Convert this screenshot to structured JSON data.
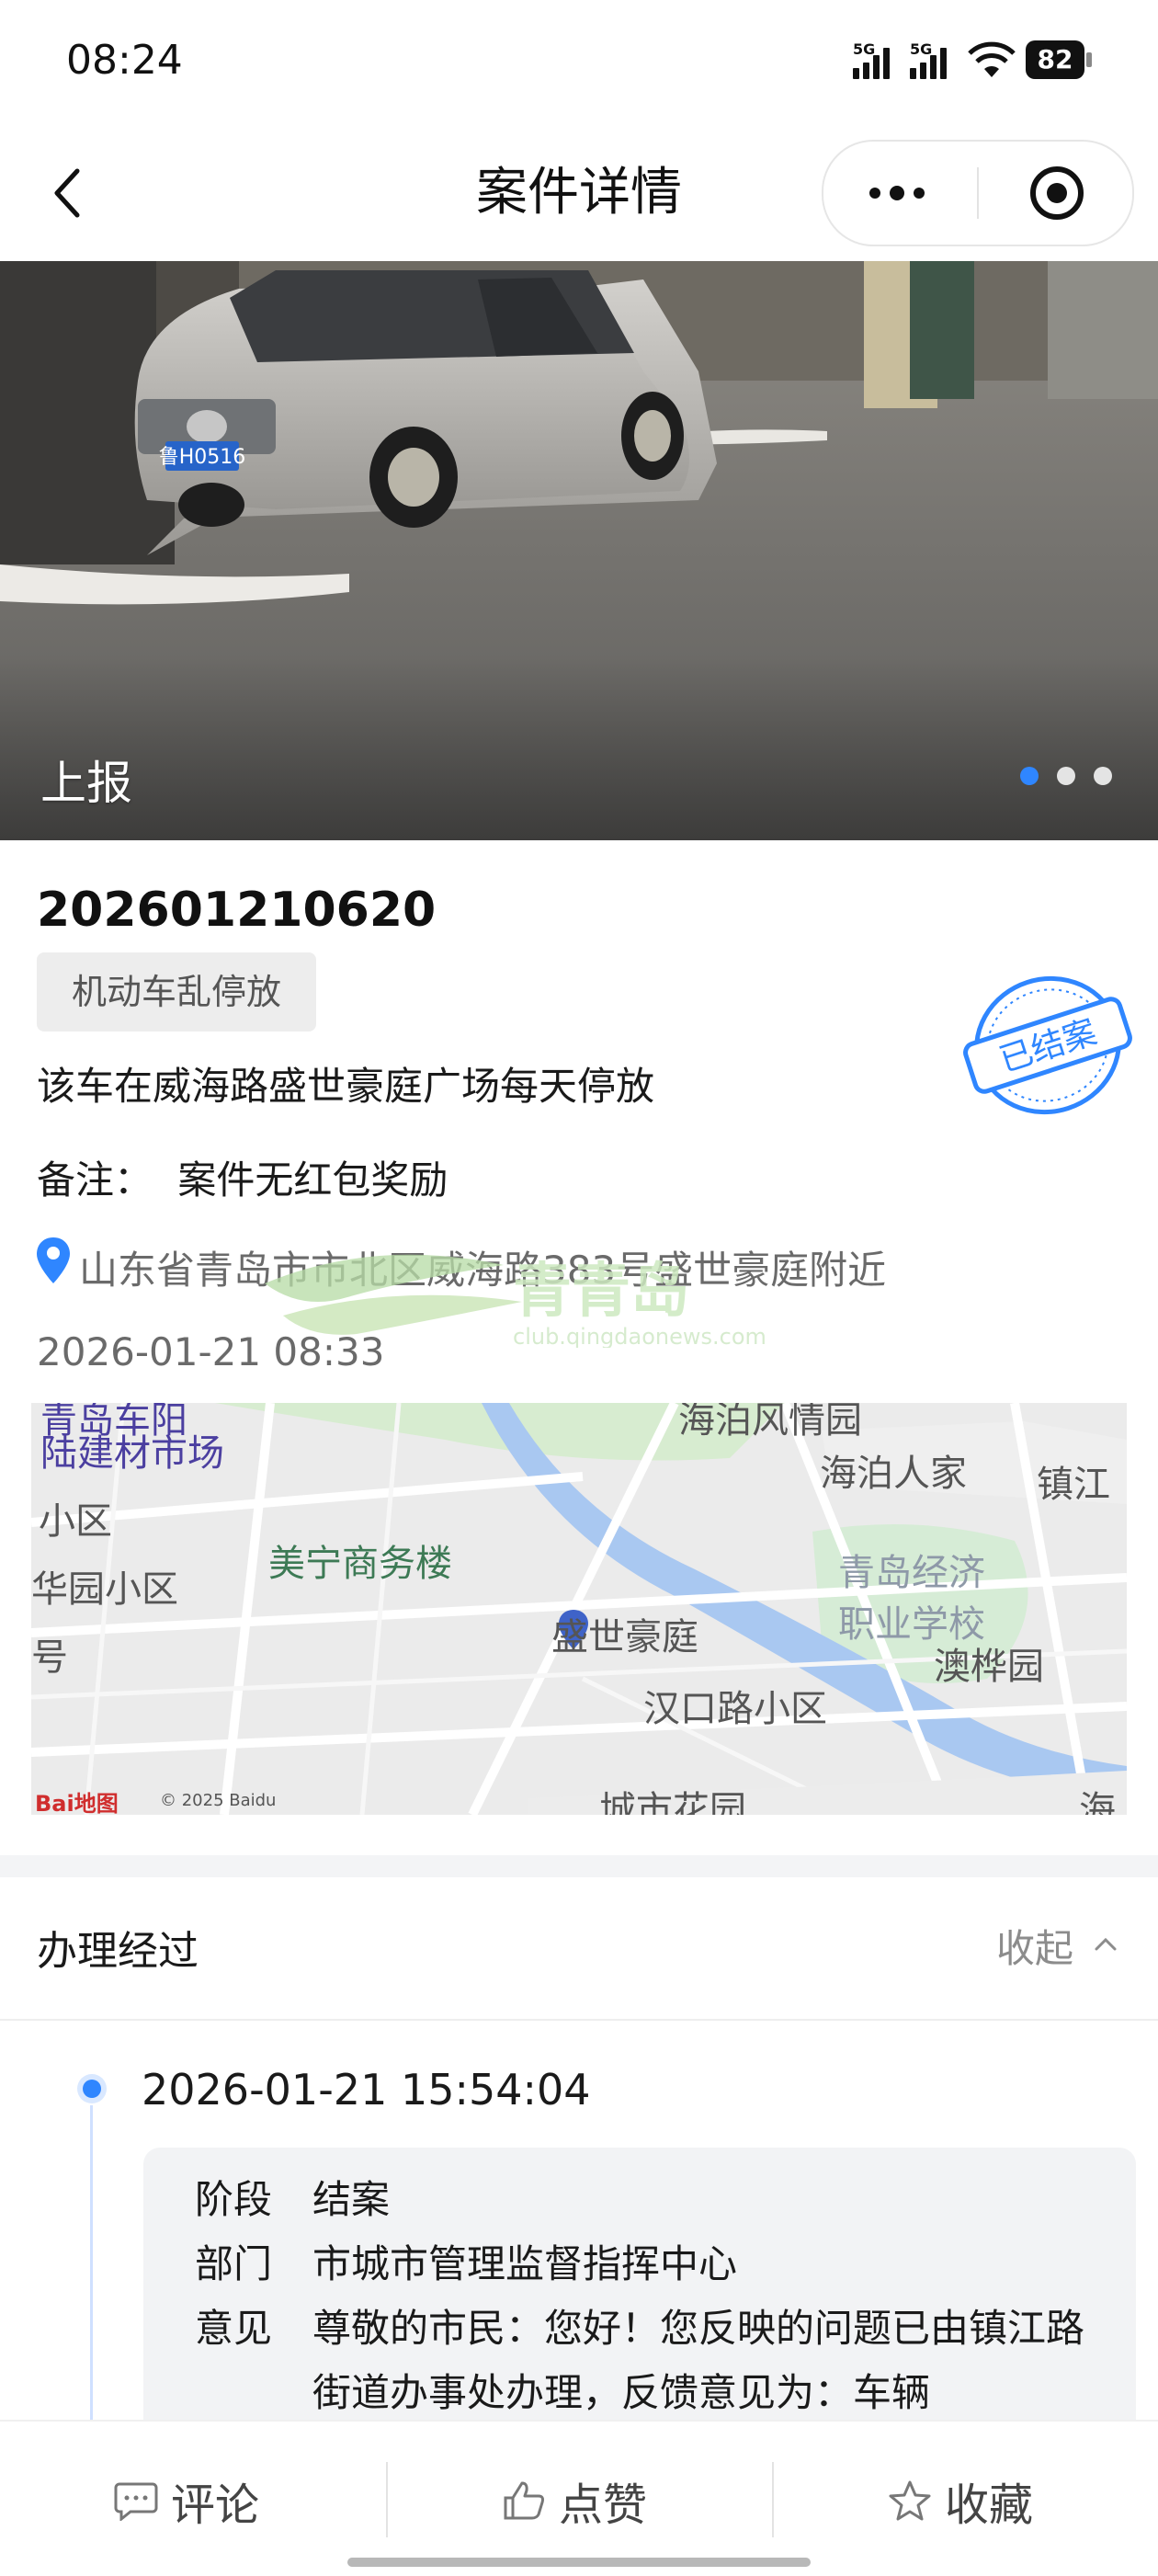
{
  "status_bar": {
    "time": "08:24",
    "signal1": "5G",
    "signal2": "5G",
    "battery": "82"
  },
  "nav": {
    "title": "案件详情"
  },
  "carousel": {
    "label": "上报",
    "dots": 3,
    "active_dot": 1
  },
  "case": {
    "number": "202601210620",
    "category": "机动车乱停放",
    "description": "该车在威海路盛世豪庭广场每天停放",
    "remark_label": "备注：",
    "remark_value": "案件无红包奖励",
    "address": "山东省青岛市市北区威海路383号盛世豪庭附近",
    "datetime": "2026-01-21 08:33",
    "stamp": "已结案"
  },
  "plate": "鲁H0516",
  "watermark": {
    "text": "青青岛",
    "url": "club.qingdaonews.com"
  },
  "map": {
    "labels": {
      "l1": "青岛车阳",
      "l2": "陆建材市场",
      "l3": "海泊风情园",
      "l4": "海泊人家",
      "l5": "镇江",
      "l6": "小区",
      "l7": "美宁商务楼",
      "l8": "华园小区",
      "l9": "青岛经济",
      "l10": "职业学校",
      "l11": "盛世豪庭",
      "l12": "号",
      "l13": "澳桦园",
      "l14": "汉口路小区",
      "l15": "城市花园",
      "l16": "海"
    },
    "logo": "Bai地图",
    "copyright": "© 2025 Baidu"
  },
  "process": {
    "title": "办理经过",
    "collapse": "收起",
    "entries": [
      {
        "time": "2026-01-21 15:54:04",
        "stage_label": "阶段",
        "stage": "结案",
        "dept_label": "部门",
        "dept": "市城市管理监督指挥中心",
        "opinion_label": "意见",
        "opinion": "尊敬的市民：您好！您反映的问题已由镇江路街道办事处办理，反馈意见为：车辆"
      }
    ]
  },
  "bottom": {
    "comment": "评论",
    "like": "点赞",
    "favorite": "收藏"
  }
}
